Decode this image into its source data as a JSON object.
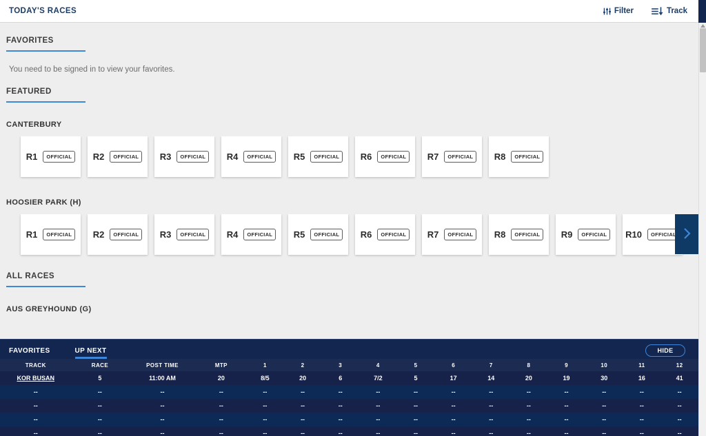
{
  "header": {
    "title": "TODAY'S RACES",
    "filter_label": "Filter",
    "filter_icon": "sliders-icon",
    "track_label": "Track",
    "track_icon": "sort-descending-icon"
  },
  "sections": {
    "favorites": {
      "title": "FAVORITES",
      "empty_message": "You need to be signed in to view your favorites."
    },
    "featured": {
      "title": "FEATURED",
      "tracks": [
        {
          "name": "CANTERBURY",
          "races": [
            {
              "race": "R1",
              "status": "OFFICIAL"
            },
            {
              "race": "R2",
              "status": "OFFICIAL"
            },
            {
              "race": "R3",
              "status": "OFFICIAL"
            },
            {
              "race": "R4",
              "status": "OFFICIAL"
            },
            {
              "race": "R5",
              "status": "OFFICIAL"
            },
            {
              "race": "R6",
              "status": "OFFICIAL"
            },
            {
              "race": "R7",
              "status": "OFFICIAL"
            },
            {
              "race": "R8",
              "status": "OFFICIAL"
            }
          ],
          "has_next": false
        },
        {
          "name": "HOOSIER PARK (H)",
          "races": [
            {
              "race": "R1",
              "status": "OFFICIAL"
            },
            {
              "race": "R2",
              "status": "OFFICIAL"
            },
            {
              "race": "R3",
              "status": "OFFICIAL"
            },
            {
              "race": "R4",
              "status": "OFFICIAL"
            },
            {
              "race": "R5",
              "status": "OFFICIAL"
            },
            {
              "race": "R6",
              "status": "OFFICIAL"
            },
            {
              "race": "R7",
              "status": "OFFICIAL"
            },
            {
              "race": "R8",
              "status": "OFFICIAL"
            },
            {
              "race": "R9",
              "status": "OFFICIAL"
            },
            {
              "race": "R10",
              "status": "OFFICIAL"
            }
          ],
          "has_next": true
        }
      ]
    },
    "all_races": {
      "title": "ALL RACES",
      "tracks": [
        {
          "name": "AUS GREYHOUND (G)"
        }
      ]
    }
  },
  "dock": {
    "tabs": [
      {
        "label": "FAVORITES",
        "active": false
      },
      {
        "label": "UP NEXT",
        "active": true
      }
    ],
    "hide_label": "HIDE",
    "columns": [
      "TRACK",
      "RACE",
      "POST TIME",
      "MTP",
      "1",
      "2",
      "3",
      "4",
      "5",
      "6",
      "7",
      "8",
      "9",
      "10",
      "11",
      "12"
    ],
    "rows": [
      {
        "track": "KOR BUSAN",
        "race": "5",
        "post_time": "11:00 AM",
        "mtp": "20",
        "odds": [
          "8/5",
          "20",
          "6",
          "7/2",
          "5",
          "17",
          "14",
          "20",
          "19",
          "30",
          "16",
          "41"
        ]
      },
      {
        "track": "--",
        "race": "--",
        "post_time": "--",
        "mtp": "--",
        "odds": [
          "--",
          "--",
          "--",
          "--",
          "--",
          "--",
          "--",
          "--",
          "--",
          "--",
          "--",
          "--"
        ]
      },
      {
        "track": "--",
        "race": "--",
        "post_time": "--",
        "mtp": "--",
        "odds": [
          "--",
          "--",
          "--",
          "--",
          "--",
          "--",
          "--",
          "--",
          "--",
          "--",
          "--",
          "--"
        ]
      },
      {
        "track": "--",
        "race": "--",
        "post_time": "--",
        "mtp": "--",
        "odds": [
          "--",
          "--",
          "--",
          "--",
          "--",
          "--",
          "--",
          "--",
          "--",
          "--",
          "--",
          "--"
        ]
      },
      {
        "track": "--",
        "race": "--",
        "post_time": "--",
        "mtp": "--",
        "odds": [
          "--",
          "--",
          "--",
          "--",
          "--",
          "--",
          "--",
          "--",
          "--",
          "--",
          "--",
          "--"
        ]
      }
    ]
  },
  "colors": {
    "accent_blue": "#3d86d8",
    "navy_dark": "#13264f",
    "navy_header": "#1b2b52",
    "row_a": "#0d2a56",
    "row_b": "#16224a",
    "page_bg": "#eeeeee",
    "title_navy": "#1b3c66"
  }
}
